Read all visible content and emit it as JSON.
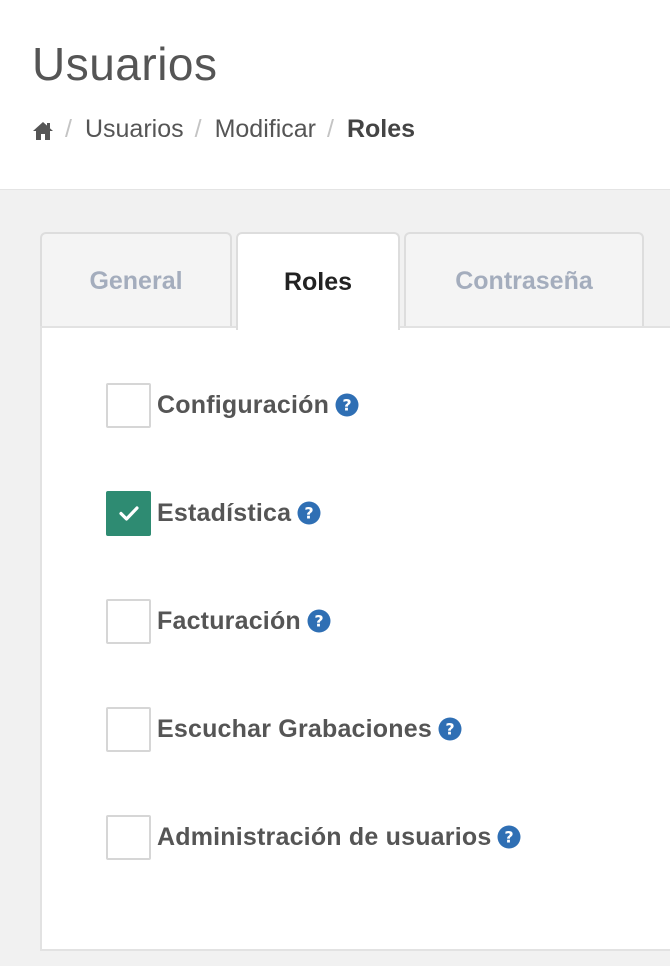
{
  "header": {
    "title": "Usuarios",
    "breadcrumb": {
      "home_icon": "home-icon",
      "separator": "/",
      "items": [
        "Usuarios",
        "Modificar",
        "Roles"
      ]
    }
  },
  "tabs": [
    {
      "label": "General",
      "active": false
    },
    {
      "label": "Roles",
      "active": true
    },
    {
      "label": "Contraseña",
      "active": false
    }
  ],
  "roles": [
    {
      "label": "Configuración",
      "checked": false,
      "icon": "help-icon"
    },
    {
      "label": "Estadística",
      "checked": true,
      "icon": "help-icon"
    },
    {
      "label": "Facturación",
      "checked": false,
      "icon": "help-icon"
    },
    {
      "label": "Escuchar Grabaciones",
      "checked": false,
      "icon": "help-icon"
    },
    {
      "label": "Administración de usuarios",
      "checked": false,
      "icon": "help-icon"
    }
  ],
  "colors": {
    "accent_checked": "#2e8b72",
    "help_icon": "#2f6fb4",
    "text": "#555555",
    "tab_inactive_text": "#a4adbd"
  }
}
